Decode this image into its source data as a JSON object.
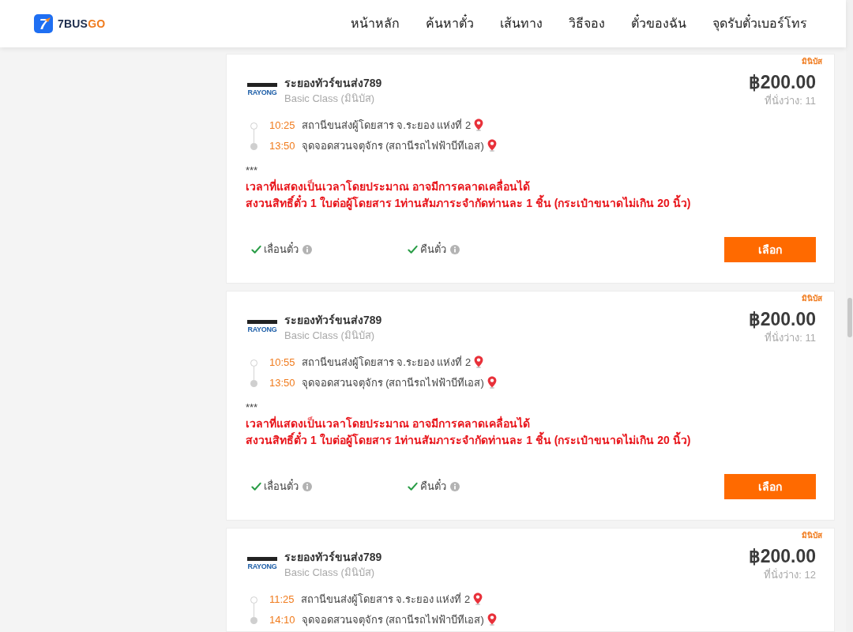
{
  "header": {
    "logo": {
      "mark": "7",
      "name": "7BUS",
      "name_accent": "GO"
    },
    "nav": [
      {
        "label": "หน้าหลัก"
      },
      {
        "label": "ค้นหาตั๋ว"
      },
      {
        "label": "เส้นทาง"
      },
      {
        "label": "วิธีจอง"
      },
      {
        "label": "ตั๋วของฉัน"
      },
      {
        "label": "จุดรับตั๋วเบอร์โทร"
      }
    ]
  },
  "trips": [
    {
      "vehicle_tag": "มินิบัส",
      "operator_logo": "RAYONG",
      "operator": "ระยองทัวร์ขนส่ง789",
      "class": "Basic Class (มินิบัส)",
      "price": "฿200.00",
      "seats": "ที่นั่งว่าง: 11",
      "stops": [
        {
          "kind": "departure",
          "time": "10:25",
          "place": "สถานีขนส่งผู้โดยสาร จ.ระยอง แห่งที่ 2"
        },
        {
          "kind": "arrival",
          "time": "13:50",
          "place": "จุดจอดสวนจตุจักร (สถานีรถไฟฟ้าบีทีเอส)"
        }
      ],
      "note_mark": "***",
      "notes": [
        "เวลาที่แสดงเป็นเวลาโดยประมาณ อาจมีการคลาดเคลื่อนได้",
        "สงวนสิทธิ์ตั๋ว 1 ใบต่อผู้โดยสาร 1ท่านสัมภาระจำกัดท่านละ 1 ชิ้น (กระเป๋าขนาดไม่เกิน 20 นิ้ว)"
      ],
      "policies": [
        {
          "label": "เลื่อนตั๋ว",
          "allowed": true
        },
        {
          "label": "คืนตั๋ว",
          "allowed": true
        }
      ],
      "button": "เลือก"
    },
    {
      "vehicle_tag": "มินิบัส",
      "operator_logo": "RAYONG",
      "operator": "ระยองทัวร์ขนส่ง789",
      "class": "Basic Class (มินิบัส)",
      "price": "฿200.00",
      "seats": "ที่นั่งว่าง: 11",
      "stops": [
        {
          "kind": "departure",
          "time": "10:55",
          "place": "สถานีขนส่งผู้โดยสาร จ.ระยอง แห่งที่ 2"
        },
        {
          "kind": "arrival",
          "time": "13:50",
          "place": "จุดจอดสวนจตุจักร (สถานีรถไฟฟ้าบีทีเอส)"
        }
      ],
      "note_mark": "***",
      "notes": [
        "เวลาที่แสดงเป็นเวลาโดยประมาณ อาจมีการคลาดเคลื่อนได้",
        "สงวนสิทธิ์ตั๋ว 1 ใบต่อผู้โดยสาร 1ท่านสัมภาระจำกัดท่านละ 1 ชิ้น (กระเป๋าขนาดไม่เกิน 20 นิ้ว)"
      ],
      "policies": [
        {
          "label": "เลื่อนตั๋ว",
          "allowed": true
        },
        {
          "label": "คืนตั๋ว",
          "allowed": true
        }
      ],
      "button": "เลือก"
    },
    {
      "vehicle_tag": "มินิบัส",
      "operator_logo": "RAYONG",
      "operator": "ระยองทัวร์ขนส่ง789",
      "class": "Basic Class (มินิบัส)",
      "price": "฿200.00",
      "seats": "ที่นั่งว่าง: 12",
      "stops": [
        {
          "kind": "departure",
          "time": "11:25",
          "place": "สถานีขนส่งผู้โดยสาร จ.ระยอง แห่งที่ 2"
        },
        {
          "kind": "arrival",
          "time": "14:10",
          "place": "จุดจอดสวนจตุจักร (สถานีรถไฟฟ้าบีทีเอส)"
        }
      ]
    }
  ]
}
